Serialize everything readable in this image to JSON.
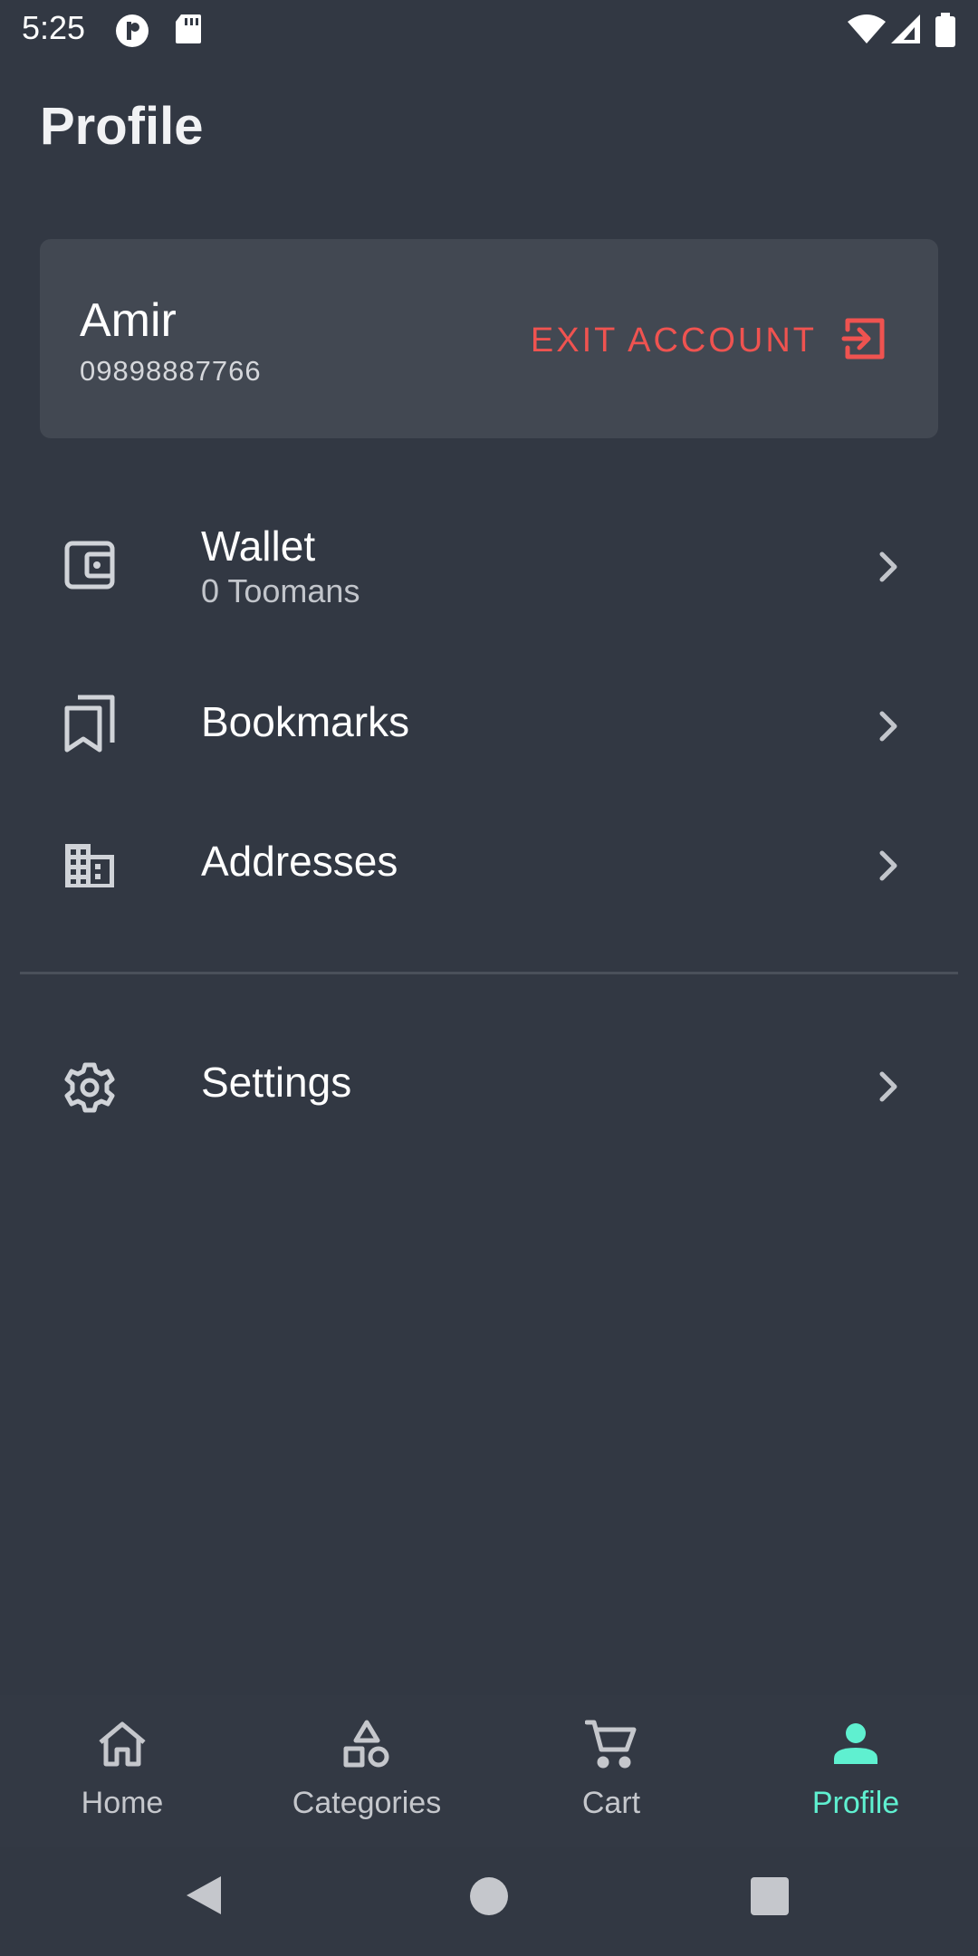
{
  "status_bar": {
    "time": "5:25",
    "icons": [
      "notification-icon",
      "sd-card-icon",
      "wifi-icon",
      "signal-icon",
      "battery-icon"
    ]
  },
  "page": {
    "title": "Profile"
  },
  "account": {
    "name": "Amir",
    "phone": "09898887766",
    "exit_label": "EXIT ACCOUNT",
    "exit_icon": "logout-icon",
    "accent": "#ef5350"
  },
  "menu": [
    {
      "icon": "wallet-icon",
      "title": "Wallet",
      "subtitle": "0 Toomans"
    },
    {
      "icon": "bookmarks-icon",
      "title": "Bookmarks"
    },
    {
      "icon": "building-icon",
      "title": "Addresses"
    },
    {
      "icon": "gear-icon",
      "title": "Settings"
    }
  ],
  "bottom_nav": {
    "items": [
      {
        "icon": "home-icon",
        "label": "Home"
      },
      {
        "icon": "shapes-icon",
        "label": "Categories"
      },
      {
        "icon": "cart-icon",
        "label": "Cart"
      },
      {
        "icon": "person-icon",
        "label": "Profile"
      }
    ],
    "active": "Profile",
    "active_color": "#5ff0d0"
  },
  "system_nav": [
    "back-icon",
    "home-circle-icon",
    "recents-icon"
  ]
}
